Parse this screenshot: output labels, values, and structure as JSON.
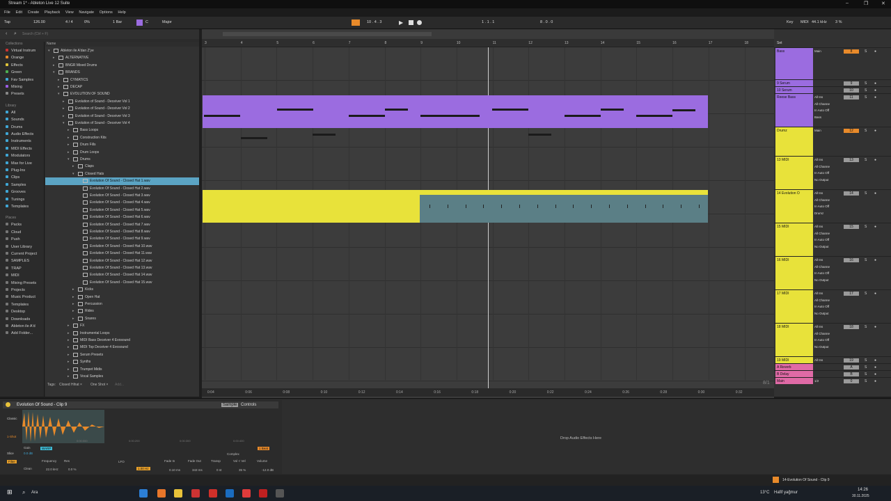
{
  "window": {
    "title": "Stream 1* - Ableton Live 12 Suite",
    "controls": [
      "–",
      "❐",
      "✕"
    ]
  },
  "menu": [
    "File",
    "Edit",
    "Create",
    "Playback",
    "View",
    "Navigate",
    "Options",
    "Help"
  ],
  "control_bar": {
    "tap": "Tap",
    "tempo": "126.00",
    "signature": "4 / 4",
    "cpu": "0%",
    "quantize": "1 Bar",
    "key": "C",
    "scale": "Major",
    "position": "10 . 4 . 3",
    "loop_start": "1 . 1 . 1",
    "loop_length": "8 . 0 . 0",
    "key_btn": "Key",
    "midi_btn": "MIDI",
    "sample_rate": "44.1 kHz",
    "cpu_load": "3 %"
  },
  "browser": {
    "search_placeholder": "Search (Ctrl + F)",
    "collections_title": "Collections",
    "collections": [
      {
        "label": "Virtual Instrum",
        "color": "#cc3333"
      },
      {
        "label": "Orange",
        "color": "#e88a2a"
      },
      {
        "label": "Effects",
        "color": "#e0c53a"
      },
      {
        "label": "Green",
        "color": "#4caf50"
      },
      {
        "label": "Fav Samples",
        "color": "#3fa7d6"
      },
      {
        "label": "Mixing",
        "color": "#9b5de5"
      },
      {
        "label": "Presets",
        "color": "#888888"
      }
    ],
    "library_title": "Library",
    "library": [
      "All",
      "Sounds",
      "Drums",
      "Audio Effects",
      "Instruments",
      "MIDI Effects",
      "Modulators",
      "Max for Live",
      "Plug-Ins",
      "Clips",
      "Samples",
      "Grooves",
      "Tunings",
      "Templates"
    ],
    "places_title": "Places",
    "places": [
      "Packs",
      "Cloud",
      "Push",
      "User Library",
      "Current Project",
      "SAMPLES",
      "TRAP",
      "MIDI",
      "Mixing Presets",
      "Projects",
      "Music Product",
      "Templates",
      "Desktop",
      "Downloads",
      "Ableton ile A'd",
      "Add Folder..."
    ],
    "name_header": "Name",
    "tree": [
      {
        "label": "Ableton ile A'dan Z'ye",
        "depth": 0,
        "open": true
      },
      {
        "label": "ALTERNATIVE",
        "depth": 1,
        "open": false
      },
      {
        "label": "BNGR Mixed Drums",
        "depth": 1,
        "open": false
      },
      {
        "label": "BRANDS",
        "depth": 1,
        "open": true
      },
      {
        "label": "CYMATICS",
        "depth": 2,
        "open": false
      },
      {
        "label": "DECAP",
        "depth": 2,
        "open": false
      },
      {
        "label": "EVOLUTION OF SOUND",
        "depth": 2,
        "open": true
      },
      {
        "label": "Evolution of Sound - Deceiver Vol 1",
        "depth": 3,
        "open": false
      },
      {
        "label": "Evolution of Sound - Deceiver Vol 2",
        "depth": 3,
        "open": false
      },
      {
        "label": "Evolution of Sound - Deceiver Vol 3",
        "depth": 3,
        "open": false
      },
      {
        "label": "Evolution of Sound - Deceiver Vol 4",
        "depth": 3,
        "open": true
      },
      {
        "label": "Bass Loops",
        "depth": 4,
        "open": false
      },
      {
        "label": "Construction Kits",
        "depth": 4,
        "open": false
      },
      {
        "label": "Drum Fills",
        "depth": 4,
        "open": false
      },
      {
        "label": "Drum Loops",
        "depth": 4,
        "open": false
      },
      {
        "label": "Drums",
        "depth": 4,
        "open": true
      },
      {
        "label": "Claps",
        "depth": 5,
        "open": false
      },
      {
        "label": "Closed Hats",
        "depth": 5,
        "open": true
      },
      {
        "label": "Evolution Of Sound - Closed Hat 1.wav",
        "depth": 6,
        "file": true,
        "selected": true
      },
      {
        "label": "Evolution Of Sound - Closed Hat 2.wav",
        "depth": 6,
        "file": true
      },
      {
        "label": "Evolution Of Sound - Closed Hat 3.wav",
        "depth": 6,
        "file": true
      },
      {
        "label": "Evolution Of Sound - Closed Hat 4.wav",
        "depth": 6,
        "file": true
      },
      {
        "label": "Evolution Of Sound - Closed Hat 5.wav",
        "depth": 6,
        "file": true
      },
      {
        "label": "Evolution Of Sound - Closed Hat 6.wav",
        "depth": 6,
        "file": true
      },
      {
        "label": "Evolution Of Sound - Closed Hat 7.wav",
        "depth": 6,
        "file": true
      },
      {
        "label": "Evolution Of Sound - Closed Hat 8.wav",
        "depth": 6,
        "file": true
      },
      {
        "label": "Evolution Of Sound - Closed Hat 9.wav",
        "depth": 6,
        "file": true
      },
      {
        "label": "Evolution Of Sound - Closed Hat 10.wav",
        "depth": 6,
        "file": true
      },
      {
        "label": "Evolution Of Sound - Closed Hat 11.wav",
        "depth": 6,
        "file": true
      },
      {
        "label": "Evolution Of Sound - Closed Hat 12.wav",
        "depth": 6,
        "file": true
      },
      {
        "label": "Evolution Of Sound - Closed Hat 13.wav",
        "depth": 6,
        "file": true
      },
      {
        "label": "Evolution Of Sound - Closed Hat 14.wav",
        "depth": 6,
        "file": true
      },
      {
        "label": "Evolution Of Sound - Closed Hat 15.wav",
        "depth": 6,
        "file": true
      },
      {
        "label": "Kicks",
        "depth": 5,
        "open": false
      },
      {
        "label": "Open Hat",
        "depth": 5,
        "open": false
      },
      {
        "label": "Percussion",
        "depth": 5,
        "open": false
      },
      {
        "label": "Rides",
        "depth": 5,
        "open": false
      },
      {
        "label": "Snares",
        "depth": 5,
        "open": false
      },
      {
        "label": "FX",
        "depth": 4,
        "open": false
      },
      {
        "label": "Instrumental Loops",
        "depth": 4,
        "open": false
      },
      {
        "label": "MIDI Bass Deceiver 4 Evosound",
        "depth": 4,
        "open": false
      },
      {
        "label": "MIDI Top Deceiver 4 Evosound",
        "depth": 4,
        "open": false
      },
      {
        "label": "Serum Presets",
        "depth": 4,
        "open": false
      },
      {
        "label": "Synths",
        "depth": 4,
        "open": false
      },
      {
        "label": "Trumpet Midis",
        "depth": 4,
        "open": false
      },
      {
        "label": "Vocal Samples",
        "depth": 4,
        "open": false
      }
    ],
    "tags_label": "Tags:",
    "tags": [
      "Closed Hihat ×",
      "One Shot ×",
      "Add..."
    ]
  },
  "arrangement": {
    "bar_labels": [
      "3",
      "4",
      "5",
      "6",
      "7",
      "8",
      "9",
      "10",
      "11",
      "12",
      "13",
      "14",
      "15",
      "16",
      "17",
      "18"
    ],
    "time_labels": [
      "0:04",
      "0:06",
      "0:08",
      "0:10",
      "0:12",
      "0:14",
      "0:16",
      "0:18",
      "0:20",
      "0:22",
      "0:24",
      "0:26",
      "0:28",
      "0:30",
      "0:32"
    ],
    "zoom": "8/1",
    "drop_hint": "Drop Audio Effects Here"
  },
  "mixer": {
    "set_label": "Set",
    "tracks": [
      {
        "name": "Bass",
        "color": "#9b6ce0",
        "io": [
          "Main"
        ],
        "num": "8",
        "tall": true
      },
      {
        "name": "9 Serum",
        "color": "#9b6ce0",
        "io": [],
        "num": "9"
      },
      {
        "name": "10 Serum",
        "color": "#9b6ce0",
        "io": [],
        "num": "10"
      },
      {
        "name": "Reese Bass",
        "color": "#9b6ce0",
        "io": [
          "All Ins",
          "All Channe",
          "In Auto Off",
          "Bass"
        ],
        "num": "11"
      },
      {
        "name": "Drumz",
        "color": "#e8e23a",
        "io": [
          "Main"
        ],
        "num": "12"
      },
      {
        "name": "13 MIDI",
        "color": "#e8e23a",
        "io": [
          "All Ins",
          "All Channe",
          "In Auto Off",
          "No Output"
        ],
        "num": "13"
      },
      {
        "name": "14 Evolution O",
        "color": "#e8e23a",
        "io": [
          "All Ins",
          "All Channe",
          "In Auto Off",
          "Drumz"
        ],
        "num": "14"
      },
      {
        "name": "15 MIDI",
        "color": "#e8e23a",
        "io": [
          "All Ins",
          "All Channe",
          "In Auto Off",
          "No Output"
        ],
        "num": "15"
      },
      {
        "name": "16 MIDI",
        "color": "#e8e23a",
        "io": [
          "All Ins",
          "All Channe",
          "In Auto Off",
          "No Output"
        ],
        "num": "16"
      },
      {
        "name": "17 MIDI",
        "color": "#e8e23a",
        "io": [
          "All Ins",
          "All Channe",
          "In Auto Off",
          "No Output"
        ],
        "num": "17"
      },
      {
        "name": "18 MIDI",
        "color": "#e8e23a",
        "io": [
          "All Ins",
          "All Channe",
          "In Auto Off",
          "No Output"
        ],
        "num": "18"
      },
      {
        "name": "19 MIDI",
        "color": "#e8e23a",
        "io": [
          "All Ins"
        ],
        "num": "19"
      },
      {
        "name": "A Reverb",
        "color": "#e06aa6",
        "io": [],
        "num": "A"
      },
      {
        "name": "B Delay",
        "color": "#e06aa6",
        "io": [],
        "num": "B"
      },
      {
        "name": "Main",
        "color": "#e06aa6",
        "io": [
          "1/2"
        ],
        "num": "0"
      }
    ]
  },
  "clip_detail": {
    "clip_name": "Evolution Of Sound - Clip 9",
    "tabs": [
      "Sample",
      "Controls"
    ],
    "modes": [
      "Classic",
      "1-Shot",
      "Slice"
    ],
    "gain_label": "Gain",
    "gain": "0.0 dB",
    "warp": "WARP",
    "time_marks": [
      "0:00:000",
      "0:00:200",
      "0:00:300",
      "0:00:400"
    ],
    "beat": "1 Beat",
    "complex": "Complex",
    "filter_label": "Filter",
    "clean": "Clean",
    "freq_label": "Frequency",
    "freq": "22.0 kHz",
    "res_label": "Res",
    "res": "0.0 %",
    "lfo": "LFO",
    "lfo_rate": "1.00 Hz",
    "fade_in_label": "Fade In",
    "fade_in": "0.10 ms",
    "fade_out_label": "Fade Out",
    "fade_out": "343 ms",
    "transp_label": "Transp",
    "transp": "0 st",
    "vol_vel_label": "Vol < Vel",
    "vol_vel": "35 %",
    "volume_label": "Volume",
    "volume": "-12.0 dB"
  },
  "status": {
    "clip": "14-Evolution Of Sound - Clip 9"
  },
  "taskbar": {
    "search": "Ara",
    "weather": "13°C",
    "weather_desc": "Hafif yağmur",
    "time": "14:26",
    "date": "30.11.2025"
  }
}
